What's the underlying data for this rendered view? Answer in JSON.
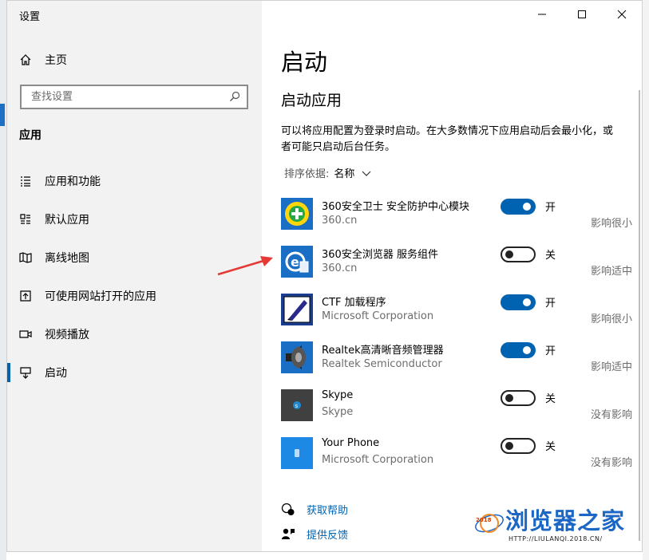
{
  "window": {
    "title": "设置"
  },
  "sidebar": {
    "home_label": "主页",
    "search_placeholder": "查找设置",
    "section_title": "应用",
    "items": [
      {
        "label": "应用和功能",
        "icon": "list-icon"
      },
      {
        "label": "默认应用",
        "icon": "default-apps-icon"
      },
      {
        "label": "离线地图",
        "icon": "map-icon"
      },
      {
        "label": "可使用网站打开的应用",
        "icon": "open-web-icon"
      },
      {
        "label": "视频播放",
        "icon": "video-icon"
      },
      {
        "label": "启动",
        "icon": "startup-icon",
        "active": true
      }
    ]
  },
  "main": {
    "title": "启动",
    "subtitle": "启动应用",
    "description": "可以将应用配置为登录时启动。在大多数情况下应用启动后会最小化，或者可能只启动后台任务。",
    "sort_label": "排序依据:",
    "sort_value": "名称",
    "apps": [
      {
        "name": "360安全卫士 安全防护中心模块",
        "publisher": "360.cn",
        "on": true,
        "state": "开",
        "impact": "影响很小",
        "icon": "360-safe-icon"
      },
      {
        "name": "360安全浏览器 服务组件",
        "publisher": "360.cn",
        "on": false,
        "state": "关",
        "impact": "影响适中",
        "icon": "360-browser-icon"
      },
      {
        "name": "CTF 加载程序",
        "publisher": "Microsoft Corporation",
        "on": true,
        "state": "开",
        "impact": "影响很小",
        "icon": "ctf-loader-icon"
      },
      {
        "name": "Realtek高清晰音频管理器",
        "publisher": "Realtek Semiconductor",
        "on": true,
        "state": "开",
        "impact": "影响适中",
        "icon": "speaker-icon"
      },
      {
        "name": "Skype",
        "publisher": "Skype",
        "on": false,
        "state": "关",
        "impact": "没有影响",
        "icon": "skype-icon"
      },
      {
        "name": "Your Phone",
        "publisher": "Microsoft Corporation",
        "on": false,
        "state": "关",
        "impact": "没有影响",
        "icon": "your-phone-icon"
      }
    ],
    "links": {
      "help": "获取帮助",
      "feedback": "提供反馈"
    }
  },
  "watermark": {
    "name": "浏览器之家",
    "url": "HTTP://LIULANQI.2018.CN/",
    "year": "2018"
  },
  "colors": {
    "accent": "#0063b1",
    "arrow": "#e53935",
    "watermark": "#1c67c5"
  }
}
